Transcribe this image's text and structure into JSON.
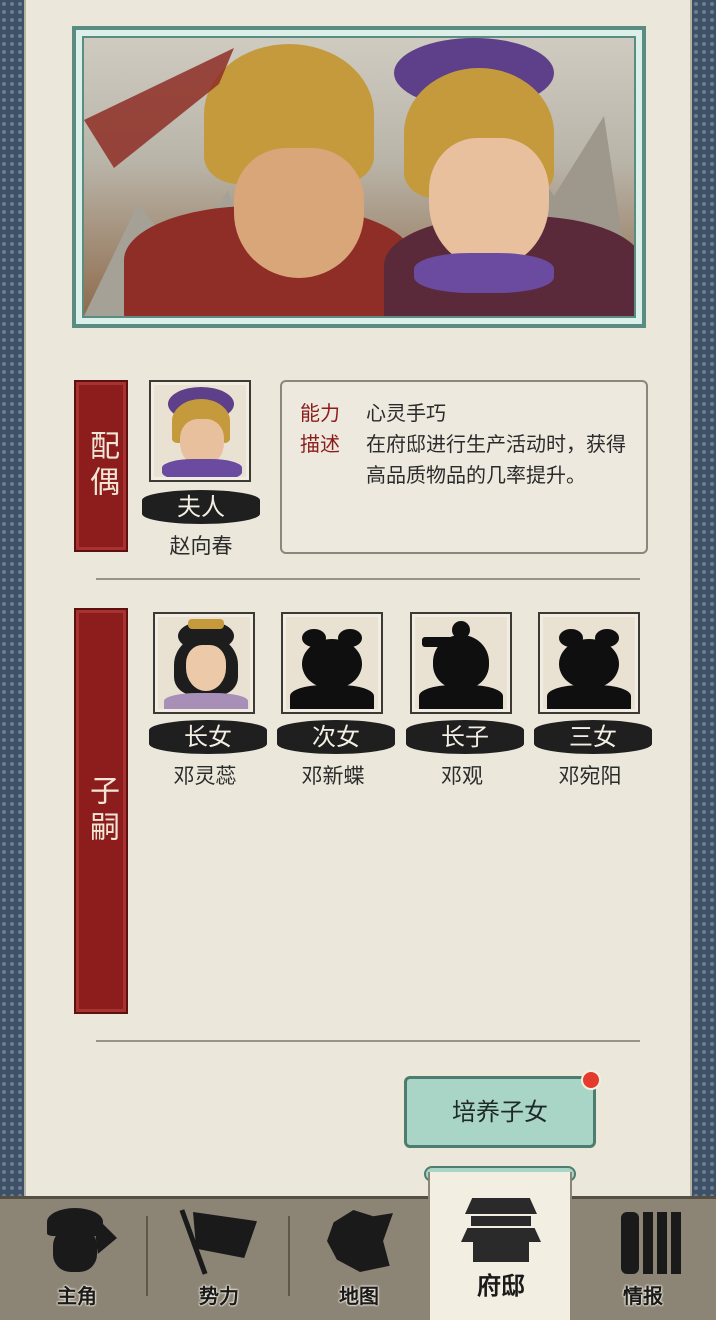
{
  "spouse": {
    "tag": "配偶",
    "title": "夫人",
    "name": "赵向春",
    "ability_label": "能力",
    "ability_value": "心灵手巧",
    "desc_label": "描述",
    "desc_value": "在府邸进行生产活动时，获得高品质物品的几率提升。"
  },
  "children": {
    "tag": "子嗣",
    "items": [
      {
        "title": "长女",
        "name": "邓灵蕊"
      },
      {
        "title": "次女",
        "name": "邓新蝶"
      },
      {
        "title": "长子",
        "name": "邓观"
      },
      {
        "title": "三女",
        "name": "邓宛阳"
      }
    ]
  },
  "actions": {
    "train_label": "培养子女"
  },
  "nav": {
    "items": [
      {
        "label": "主角",
        "icon": "warrior-icon"
      },
      {
        "label": "势力",
        "icon": "flag-icon"
      },
      {
        "label": "地图",
        "icon": "map-icon"
      },
      {
        "label": "府邸",
        "icon": "mansion-icon"
      },
      {
        "label": "情报",
        "icon": "scroll-icon"
      }
    ],
    "active": "府邸"
  },
  "colors": {
    "accent_red": "#8c1d1c",
    "jade": "#a9d5c6",
    "paper": "#ebe7db"
  }
}
